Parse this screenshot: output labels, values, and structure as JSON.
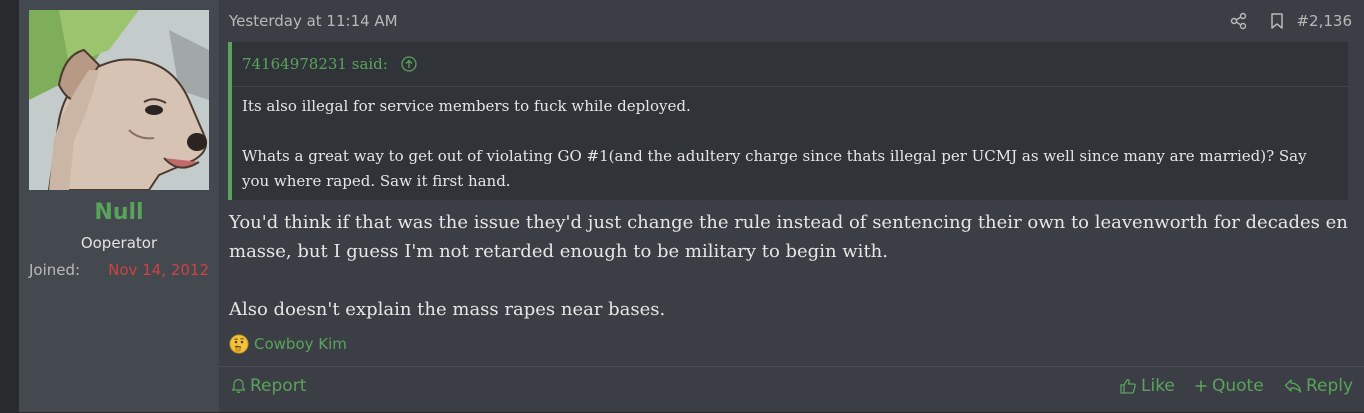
{
  "post": {
    "number": "#2,136",
    "timestamp": "Yesterday at 11:14 AM"
  },
  "user": {
    "name": "Null",
    "title": "Ooperator",
    "joined_label": "Joined:",
    "joined_date": "Nov 14, 2012",
    "avatar_icon": "dog-avatar-icon"
  },
  "quote": {
    "author_said": "74164978231 said:",
    "lines": [
      "Its also illegal for service members to fuck while deployed.",
      "Whats a great way to get out of violating GO #1(and the adultery charge since thats illegal per UCMJ as well since many are married)? Say you where raped. Saw it first hand."
    ]
  },
  "message": {
    "paragraphs": [
      "You'd think if that was the issue they'd just change the rule instead of sentencing their own to leavenworth for decades en masse, but I guess I'm not retarded enough to be military to begin with.",
      "Also doesn't explain the mass rapes near bases."
    ]
  },
  "reactions": {
    "icon": "thinking-emoji-icon",
    "users": "Cowboy Kim"
  },
  "actions": {
    "report": "Report",
    "like": "Like",
    "quote": "Quote",
    "reply": "Reply"
  },
  "colors": {
    "accent_green": "#5aa35c",
    "username_green": "#58a45b",
    "joined_red": "#cc4444",
    "post_bg": "#3b3e44",
    "user_bg": "#44484f"
  }
}
